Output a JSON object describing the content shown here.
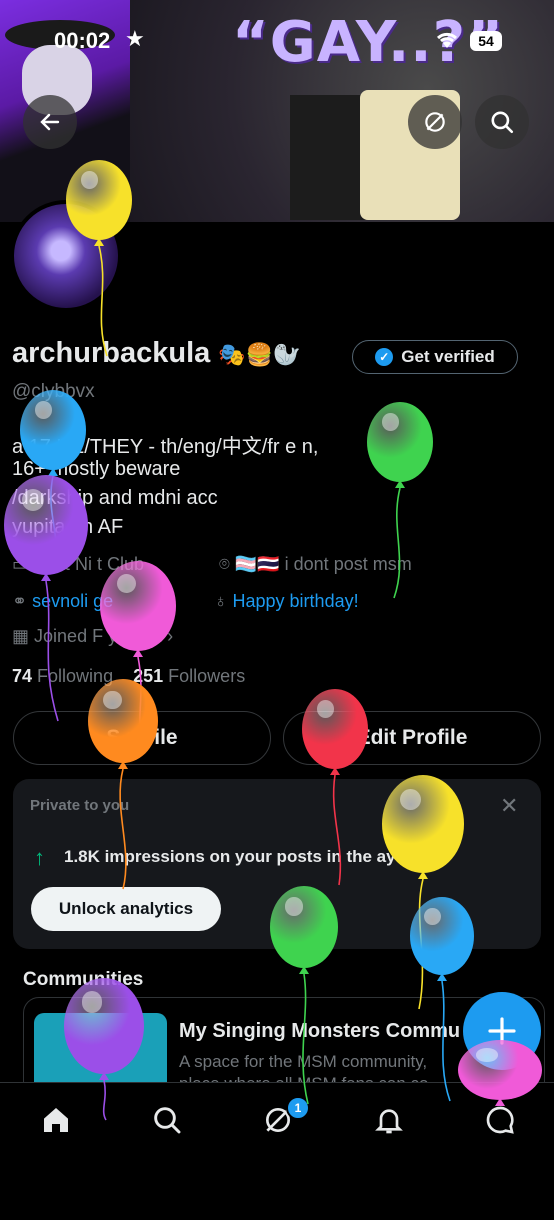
{
  "status_bar": {
    "time": "00:02",
    "battery": "54",
    "star_icon": "star-icon",
    "wifi_icon": "wifi-icon"
  },
  "banner": {
    "text": "“GAY..?”"
  },
  "header_buttons": {
    "back_icon": "arrow-left-icon",
    "hide_icon": "eye-slash-icon",
    "search_icon": "search-icon"
  },
  "profile": {
    "name": "archurbackula",
    "emojis": "🎭🍔🦭",
    "handle": "@clybbvx",
    "get_verified_label": "Get verified",
    "bio": [
      "a  17 HE/THEY - th/eng/中文/fr e  n,",
      "16+ mostly beware",
      "   /darkship and mdni acc",
      "   yupita on AF"
    ],
    "meta_affiliation": "   ce & Ni  t Club",
    "meta_location": "🏳️‍⚧️🇹🇭 i dont post msm",
    "meta_link": "sevnoli      ge",
    "meta_birthday": "Happy birthday!",
    "meta_joined": "Joined F      y 2022",
    "following_count": "74",
    "following_label": "Following",
    "followers_count": "251",
    "followers_label": "Followers",
    "share_label": "S      rofile",
    "edit_label": "Edit Profile"
  },
  "analytics_card": {
    "title": "Private to you",
    "text": "1.8K impressions on your posts in the       ays",
    "unlock_label": "Unlock analytics"
  },
  "communities": {
    "title": "Communities",
    "name": "My Singing Monsters Commu",
    "desc_line1": "A space for the MSM community,",
    "desc_line2": "place where all MSM fans can co"
  },
  "tabbar": {
    "notifications_badge": "1"
  },
  "balloon_colors": {
    "yellow": "#f7e12a",
    "blue": "#29a8f5",
    "purple": "#9b4fe8",
    "green": "#3fd34f",
    "pink": "#f05ad8",
    "orange": "#ff8a1f",
    "red": "#f2344a"
  }
}
